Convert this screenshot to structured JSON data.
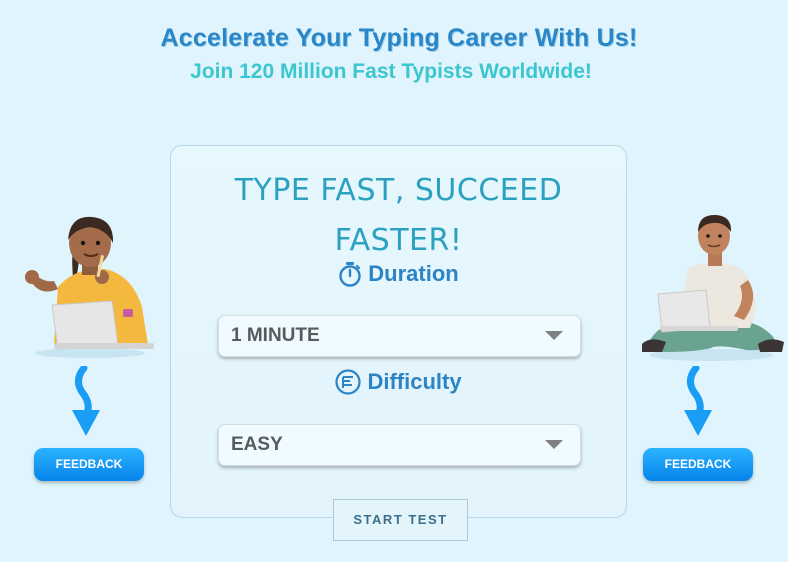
{
  "header": {
    "title": "Accelerate Your Typing Career With Us!",
    "subtitle": "Join 120 Million Fast Typists Worldwide!"
  },
  "card": {
    "title_line1": "TYPE FAST, SUCCEED",
    "title_line2": "FASTER!",
    "duration": {
      "label": "Duration",
      "icon": "stopwatch-icon",
      "selected": "1 MINUTE"
    },
    "difficulty": {
      "label": "Difficulty",
      "icon": "list-circle-icon",
      "selected": "EASY"
    },
    "start_button": "START TEST"
  },
  "feedback": {
    "left_label": "FEEDBACK",
    "right_label": "FEEDBACK"
  },
  "colors": {
    "background": "#dff4fd",
    "title": "#2a86c6",
    "subtitle": "#3cc6cf",
    "card_title": "#2aa1c0",
    "feedback_button": "#0a8ff0",
    "arrow": "#1a9ef5"
  }
}
